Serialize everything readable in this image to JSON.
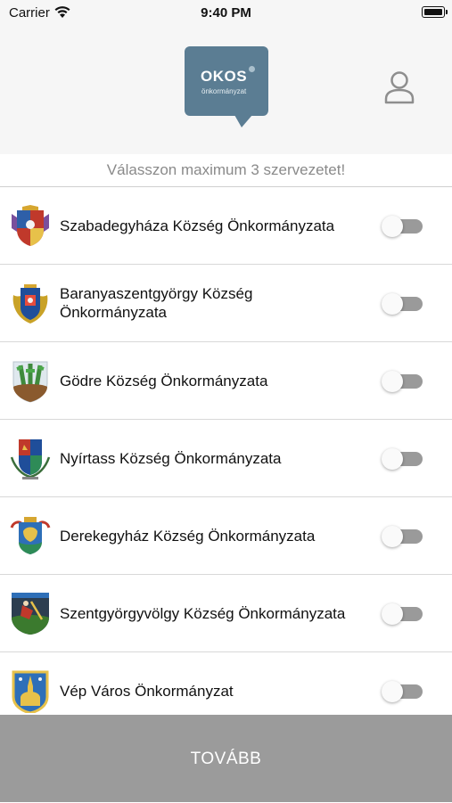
{
  "status_bar": {
    "carrier": "Carrier",
    "time": "9:40 PM"
  },
  "header": {
    "logo_title": "OKOS",
    "logo_subtitle": "önkormányzat",
    "accent_color": "#5b7d93"
  },
  "instruction": "Válasszon maximum 3 szervezetet!",
  "organizations": [
    {
      "name": "Szabadegyháza Község Önkormányzata",
      "selected": false,
      "crest": "szabadegyhaza-crest"
    },
    {
      "name": "Baranyaszentgyörgy Község Önkormányzata",
      "selected": false,
      "crest": "baranyaszentgyorgy-crest"
    },
    {
      "name": "Gödre Község Önkormányzata",
      "selected": false,
      "crest": "godre-crest"
    },
    {
      "name": "Nyírtass Község Önkormányzata",
      "selected": false,
      "crest": "nyirtass-crest"
    },
    {
      "name": "Derekegyház Község Önkormányzata",
      "selected": false,
      "crest": "derekegyhaz-crest"
    },
    {
      "name": "Szentgyörgyvölgy Község Önkormányzata",
      "selected": false,
      "crest": "szentgyorgyvolgy-crest"
    },
    {
      "name": "Vép Város Önkormányzat",
      "selected": false,
      "crest": "vep-crest"
    }
  ],
  "next_button_label": "TOVÁBB"
}
